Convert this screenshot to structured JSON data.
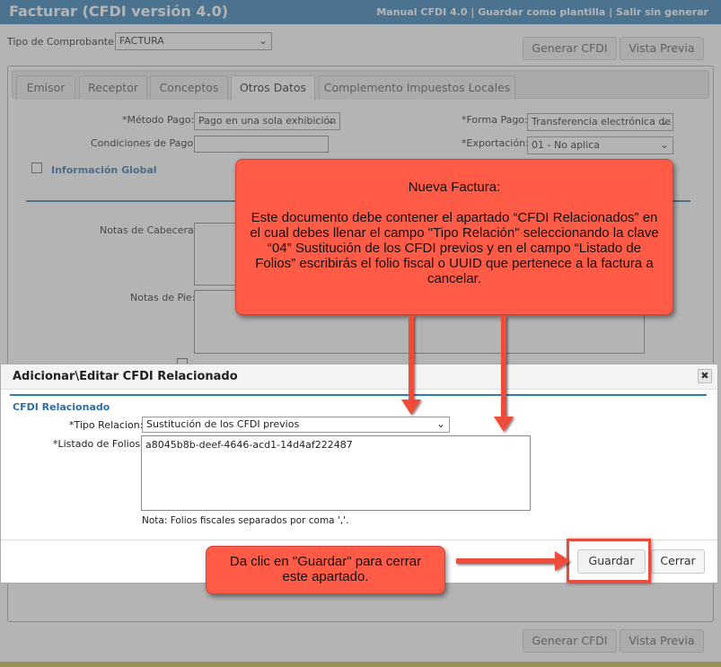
{
  "window": {
    "title": "Facturar (CFDI versión 4.0)",
    "links": [
      "Manual CFDI 4.0",
      "Guardar como plantilla",
      "Salir sin generar"
    ],
    "link_separator": " | "
  },
  "top": {
    "tipo_label": "Tipo de Comprobante:",
    "tipo_value": "FACTURA",
    "generar_label": "Generar CFDI",
    "vista_label": "Vista Previa"
  },
  "tabs": [
    {
      "label": "Emisor",
      "active": false
    },
    {
      "label": "Receptor",
      "active": false
    },
    {
      "label": "Conceptos",
      "active": false
    },
    {
      "label": "Otros Datos",
      "active": true
    },
    {
      "label": "Complemento Impuestos Locales",
      "active": false
    }
  ],
  "otros": {
    "metodo_label": "*Método Pago:",
    "metodo_value": "Pago en una sola exhibición",
    "forma_label": "*Forma Pago:",
    "forma_value": "Transferencia electrónica de fondos",
    "condiciones_label": "Condiciones de Pago:",
    "exportacion_label": "*Exportación:",
    "exportacion_value": "01 - No aplica",
    "info_global_label": "Información Global",
    "notas_cabecera_label": "Notas de Cabecera:",
    "notas_pie_label": "Notas de Pie:"
  },
  "modal": {
    "title": "Adicionar\\Editar CFDI Relacionado",
    "close_glyph": "✖",
    "section": "CFDI Relacionado",
    "tipo_relacion_label": "*Tipo Relacion:",
    "tipo_relacion_value": "Sustitución de los CFDI previos",
    "folios_label": "*Listado de Folios:",
    "folios_value": "a8045b8b-deef-4646-acd1-14d4af222487",
    "nota": "Nota: Folios fiscales separados por coma ','.",
    "guardar_label": "Guardar",
    "cerrar_label": "Cerrar"
  },
  "callouts": {
    "main_title": "Nueva Factura:",
    "main_body": "Este documento debe contener el apartado “CFDI Relacionados” en el cual debes llenar el campo \"Tipo Relación\" seleccionando la clave “04” Sustitución de los CFDI previos y en el campo “Listado de Folios” escribirás el folio fiscal o UUID que pertenece a la factura a cancelar.",
    "guardar_hint": "Da clic en \"Guardar\" para cerrar este apartado."
  },
  "bottom": {
    "generar_label": "Generar CFDI",
    "vista_label": "Vista Previa"
  },
  "colors": {
    "title_bar": "#2d7bb5",
    "callout": "#ff5b47",
    "highlight": "#e74c3c",
    "section_text": "#2d6ea8"
  }
}
